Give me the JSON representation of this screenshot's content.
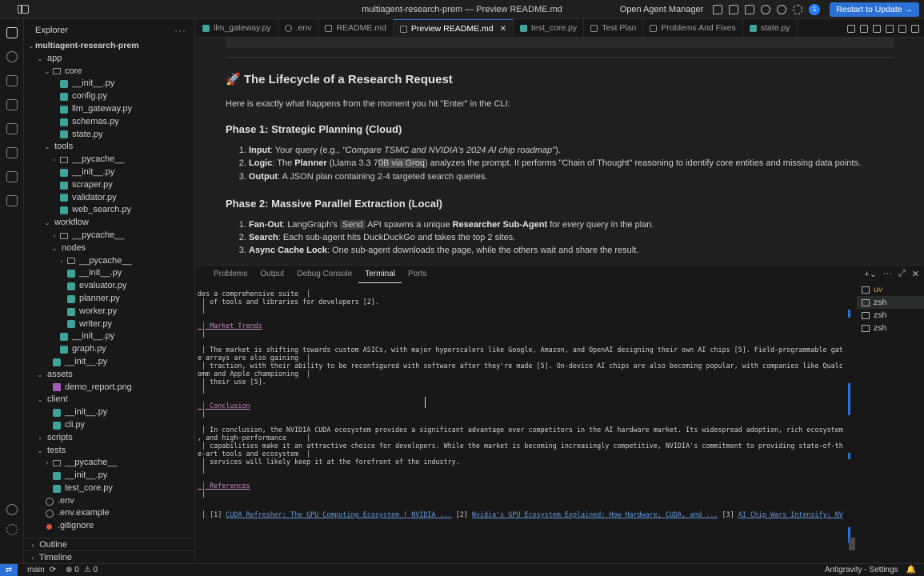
{
  "window": {
    "title": "multiagent-research-prem — Preview README.md",
    "agent_manager": "Open Agent Manager",
    "notif_count": "1",
    "update_button": "Restart to Update →"
  },
  "sidebar": {
    "title": "Explorer",
    "more": "···",
    "tree": [
      {
        "label": "multiagent-research-prem",
        "depth": 0,
        "kind": "root",
        "chev": "⌄"
      },
      {
        "label": "app",
        "depth": 1,
        "kind": "folder-plain",
        "chev": "⌄"
      },
      {
        "label": "core",
        "depth": 2,
        "kind": "folder",
        "chev": "⌄"
      },
      {
        "label": "__init__.py",
        "depth": 3,
        "kind": "py"
      },
      {
        "label": "config.py",
        "depth": 3,
        "kind": "py"
      },
      {
        "label": "llm_gateway.py",
        "depth": 3,
        "kind": "py"
      },
      {
        "label": "schemas.py",
        "depth": 3,
        "kind": "py"
      },
      {
        "label": "state.py",
        "depth": 3,
        "kind": "py"
      },
      {
        "label": "tools",
        "depth": 2,
        "kind": "folder-plain",
        "chev": "⌄"
      },
      {
        "label": "__pycache__",
        "depth": 3,
        "kind": "folder",
        "chev": "›"
      },
      {
        "label": "__init__.py",
        "depth": 3,
        "kind": "py"
      },
      {
        "label": "scraper.py",
        "depth": 3,
        "kind": "py"
      },
      {
        "label": "validator.py",
        "depth": 3,
        "kind": "py"
      },
      {
        "label": "web_search.py",
        "depth": 3,
        "kind": "py"
      },
      {
        "label": "workflow",
        "depth": 2,
        "kind": "folder-plain",
        "chev": "⌄"
      },
      {
        "label": "__pycache__",
        "depth": 3,
        "kind": "folder",
        "chev": "›"
      },
      {
        "label": "nodes",
        "depth": 3,
        "kind": "folder-plain",
        "chev": "⌄"
      },
      {
        "label": "__pycache__",
        "depth": 4,
        "kind": "folder",
        "chev": "›"
      },
      {
        "label": "__init__.py",
        "depth": 4,
        "kind": "py"
      },
      {
        "label": "evaluator.py",
        "depth": 4,
        "kind": "py"
      },
      {
        "label": "planner.py",
        "depth": 4,
        "kind": "py"
      },
      {
        "label": "worker.py",
        "depth": 4,
        "kind": "py"
      },
      {
        "label": "writer.py",
        "depth": 4,
        "kind": "py"
      },
      {
        "label": "__init__.py",
        "depth": 3,
        "kind": "py"
      },
      {
        "label": "graph.py",
        "depth": 3,
        "kind": "py"
      },
      {
        "label": "__init__.py",
        "depth": 2,
        "kind": "py"
      },
      {
        "label": "assets",
        "depth": 1,
        "kind": "folder-plain",
        "chev": "⌄"
      },
      {
        "label": "demo_report.png",
        "depth": 2,
        "kind": "png"
      },
      {
        "label": "client",
        "depth": 1,
        "kind": "folder-plain",
        "chev": "⌄"
      },
      {
        "label": "__init__.py",
        "depth": 2,
        "kind": "py"
      },
      {
        "label": "cli.py",
        "depth": 2,
        "kind": "py"
      },
      {
        "label": "scripts",
        "depth": 1,
        "kind": "folder-plain",
        "chev": "›"
      },
      {
        "label": "tests",
        "depth": 1,
        "kind": "folder-plain",
        "chev": "⌄"
      },
      {
        "label": "__pycache__",
        "depth": 2,
        "kind": "folder",
        "chev": "›"
      },
      {
        "label": "__init__.py",
        "depth": 2,
        "kind": "py"
      },
      {
        "label": "test_core.py",
        "depth": 2,
        "kind": "py"
      },
      {
        "label": ".env",
        "depth": 1,
        "kind": "env"
      },
      {
        "label": ".env.example",
        "depth": 1,
        "kind": "env"
      },
      {
        "label": ".gitignore",
        "depth": 1,
        "kind": "git"
      }
    ],
    "outline": "Outline",
    "timeline": "Timeline"
  },
  "tabs": [
    {
      "label": "llm_gateway.py",
      "icon": "python-file-icon",
      "active": false
    },
    {
      "label": ".env",
      "icon": "gear-file-icon",
      "active": false
    },
    {
      "label": "README.md",
      "icon": "markdown-file-icon",
      "active": false
    },
    {
      "label": "Preview README.md",
      "icon": "preview-icon",
      "active": true
    },
    {
      "label": "test_core.py",
      "icon": "python-file-icon",
      "active": false
    },
    {
      "label": "Test Plan",
      "icon": "document-icon",
      "active": false
    },
    {
      "label": "Problems And Fixes",
      "icon": "document-icon",
      "active": false
    },
    {
      "label": "state.py",
      "icon": "python-file-icon",
      "active": false
    }
  ],
  "preview": {
    "h2": "🚀 The Lifecycle of a Research Request",
    "intro": "Here is exactly what happens from the moment you hit \"Enter\" in the CLI:",
    "phase1": {
      "title": "Phase 1: Strategic Planning (Cloud)",
      "items": [
        {
          "bold": "Input",
          "text": ": Your query (e.g., ",
          "italic": "\"Compare TSMC and NVIDIA's 2024 AI chip roadmap\"",
          "tail": ")."
        },
        {
          "bold": "Logic",
          "text": ": The ",
          "bold2": "Planner",
          "mid": " (Llama 3.3 7",
          "hl": "0B via Groq",
          "tail": ") analyzes the prompt. It performs \"Chain of Thought\" reasoning to identify core entities and missing data points."
        },
        {
          "bold": "Output",
          "text": ": A JSON plan containing 2-4 targeted search queries."
        }
      ]
    },
    "phase2": {
      "title": "Phase 2: Massive Parallel Extraction (Local)",
      "items": [
        {
          "bold": "Fan-Out",
          "text": ": LangGraph's ",
          "code": "Send",
          "mid": " API spawns a unique ",
          "bold2": "Researcher Sub-Agent",
          "mid2": " for ",
          "italic": "every",
          "tail": " query in the plan."
        },
        {
          "bold": "Search",
          "text": ": Each sub-agent hits DuckDuckGo and takes the top 2 sites."
        },
        {
          "bold": "Async Cache Lock",
          "text": ": One sub-agent downloads the page, while the others wait and share the result."
        }
      ]
    }
  },
  "panel": {
    "tabs": [
      "Problems",
      "Output",
      "Debug Console",
      "Terminal",
      "Ports"
    ],
    "active_tab": "Terminal",
    "terminals": [
      {
        "label": "uv",
        "selected": false
      },
      {
        "label": "zsh",
        "selected": true
      },
      {
        "label": "zsh",
        "selected": false
      },
      {
        "label": "zsh",
        "selected": false
      }
    ],
    "lines": [
      {
        "text": "des a comprehensive suite  │",
        "style": "normal"
      },
      {
        "text": " │ of tools and libraries for developers [2].",
        "style": "normal"
      },
      {
        "text": " │",
        "style": "normal"
      },
      {
        "text": " │ Market Trends",
        "style": "head"
      },
      {
        "text": " │",
        "style": "normal"
      },
      {
        "text": " │ The market is shifting towards custom ASICs, with major hyperscalers like Google, Amazon, and OpenAI designing their own AI chips [5]. Field-programmable gat",
        "style": "normal"
      },
      {
        "text": "e arrays are also gaining  │",
        "style": "normal"
      },
      {
        "text": " │ traction, with their ability to be reconfigured with software after they're made [5]. On-device AI chips are also becoming popular, with companies like Qualc",
        "style": "normal"
      },
      {
        "text": "omm and Apple championing  │",
        "style": "normal"
      },
      {
        "text": " │ their use [5].",
        "style": "normal"
      },
      {
        "text": " │",
        "style": "normal"
      },
      {
        "text": " │ Conclusion",
        "style": "head"
      },
      {
        "text": " │",
        "style": "normal"
      },
      {
        "text": " │ In conclusion, the NVIDIA CUDA ecosystem provides a significant advantage over competitors in the AI hardware market. Its widespread adoption, rich ecosystem",
        "style": "normal"
      },
      {
        "text": ", and high-performance     │",
        "style": "normal"
      },
      {
        "text": " │ capabilities make it an attractive choice for developers. While the market is becoming increasingly competitive, NVIDIA's commitment to providing state-of-th",
        "style": "normal"
      },
      {
        "text": "e-art tools and ecosystem  │",
        "style": "normal"
      },
      {
        "text": " │ services will likely keep it at the forefront of the industry.",
        "style": "normal"
      },
      {
        "text": " │",
        "style": "normal"
      },
      {
        "text": " │ References",
        "style": "head"
      },
      {
        "text": " │",
        "style": "normal"
      }
    ],
    "refs": {
      "prefix": " │ [1] ",
      "link1": "CUDA Refresher: The GPU Computing Ecosystem | NVIDIA ...",
      "sep2": " [2] ",
      "link2": "Nvidia's GPU Ecosystem Explained: How Hardware, CUDA, and ...",
      "sep3": " [3] ",
      "link3": "AI Chip Wars Intensify: NV"
    }
  },
  "statusbar": {
    "branch": "main",
    "sync": "⟳",
    "errors": "⊗ 0",
    "warnings": "⚠ 0",
    "right": "Antigravity - Settings",
    "bell": "🔔"
  }
}
